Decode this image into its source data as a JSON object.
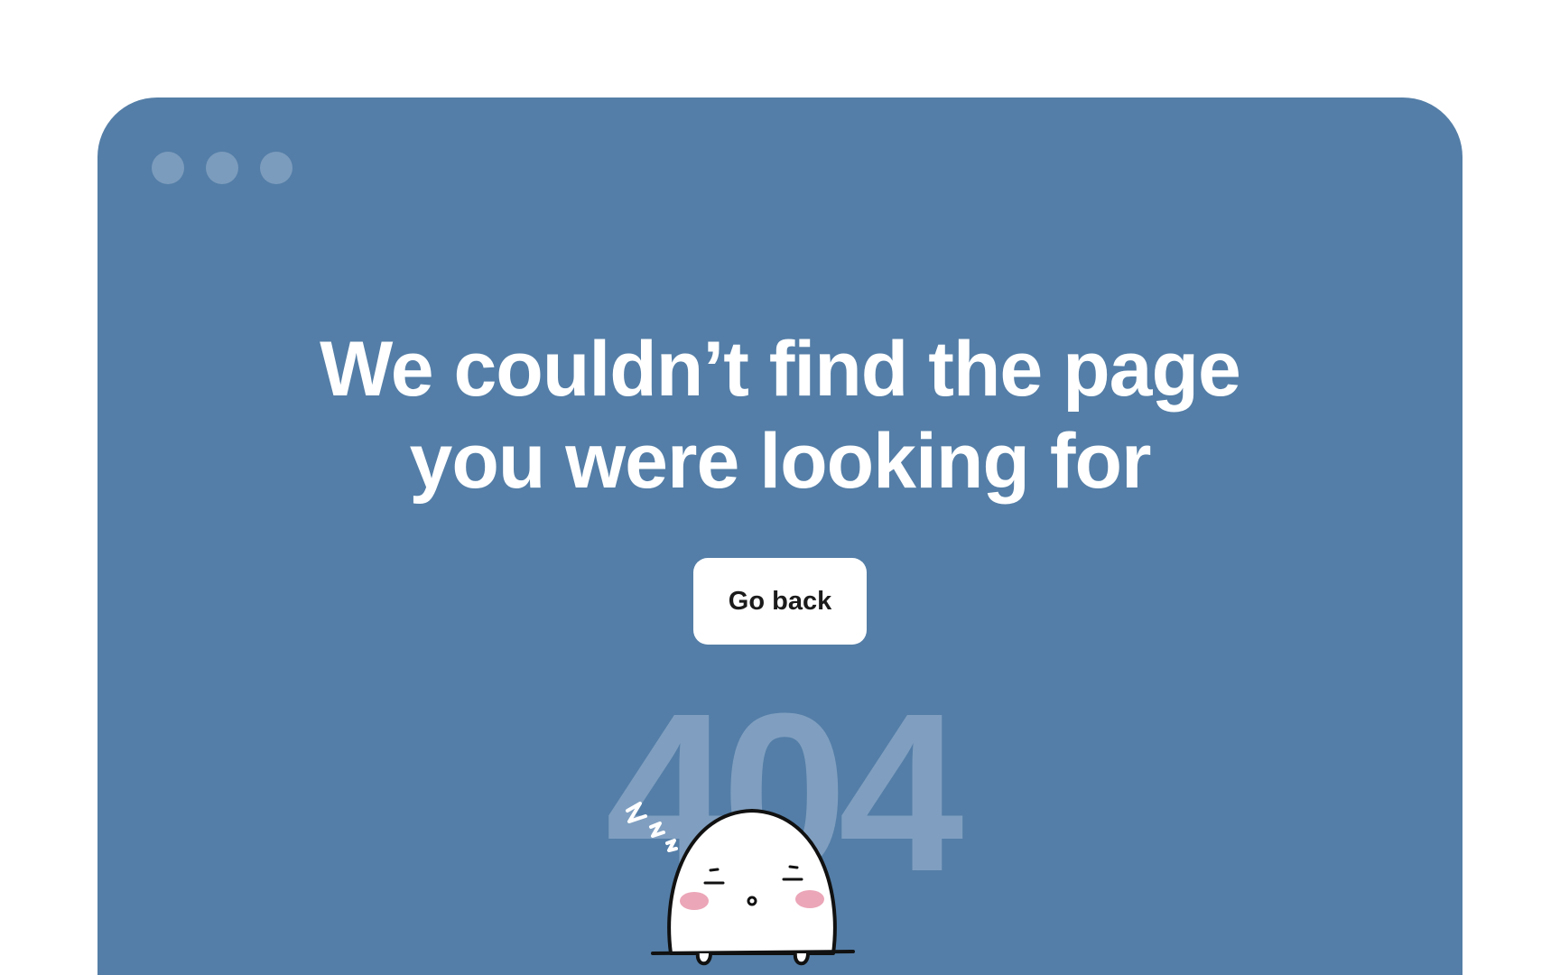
{
  "window": {
    "controls": [
      "dot-1",
      "dot-2",
      "dot-3"
    ]
  },
  "main": {
    "headline_line1": "We couldn’t find the page",
    "headline_line2": "you were looking for",
    "button_label": "Go back",
    "error_code": "404"
  },
  "colors": {
    "page_background": "#ffffff",
    "card_background": "#547ea7",
    "window_dots": "#7c9cbd",
    "code_text": "#809fc0",
    "headline_text": "#ffffff",
    "button_background": "#ffffff",
    "button_text": "#1b1b1b",
    "ghost_cheeks": "#eba6b8"
  },
  "illustration": {
    "icon": "sleeping-ghost-icon"
  }
}
